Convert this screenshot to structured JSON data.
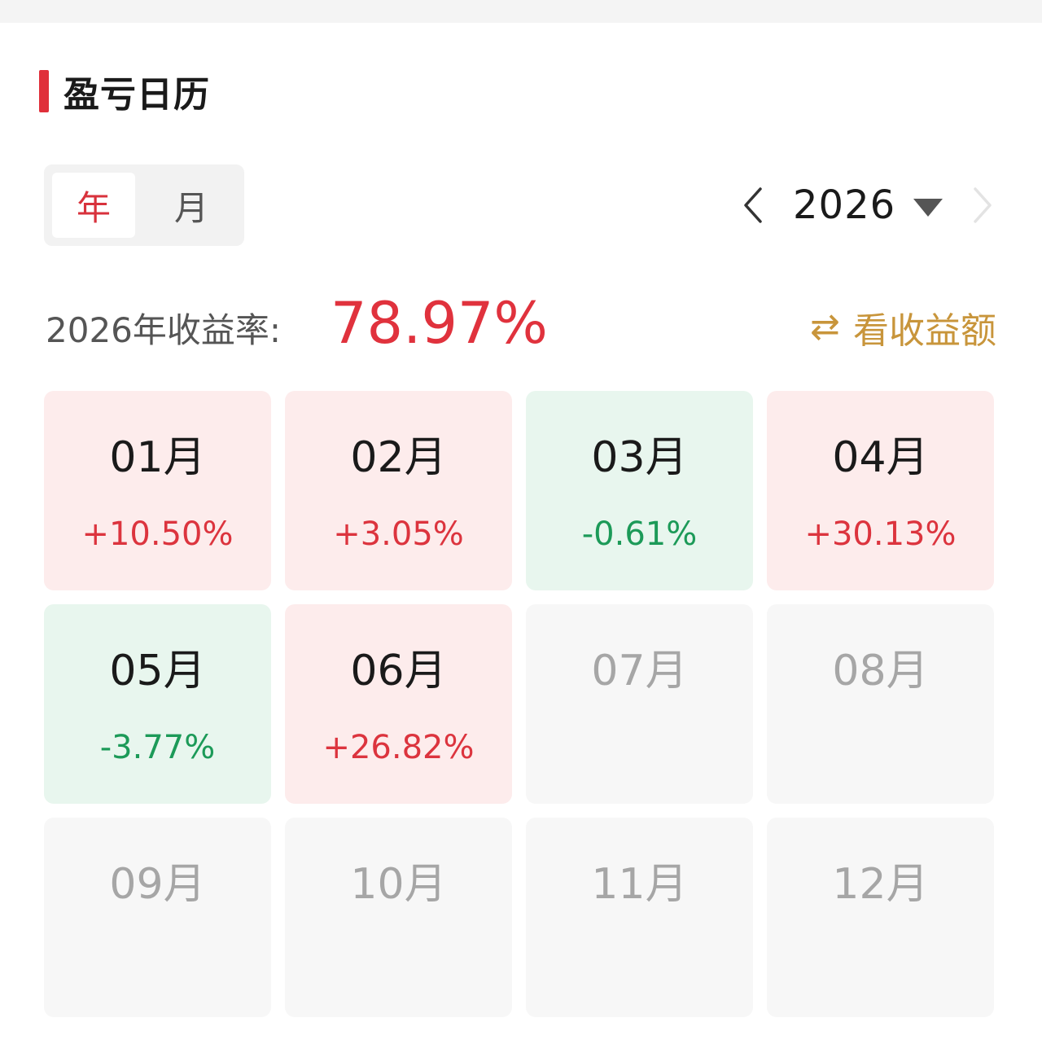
{
  "section": {
    "title": "盈亏日历"
  },
  "period_tabs": [
    {
      "label": "年",
      "active": true
    },
    {
      "label": "月",
      "active": false
    }
  ],
  "year_nav": {
    "year": "2026",
    "prev_icon": "chevron-left-icon",
    "next_icon": "chevron-right-icon",
    "next_enabled": false
  },
  "annual_return": {
    "label": "2026年收益率:",
    "value": "78.97%"
  },
  "view_toggle": {
    "icon": "swap-arrows-icon",
    "label": "看收益额"
  },
  "colors": {
    "accent": "#e02f3a",
    "gain_text": "#dc343e",
    "gain_bg": "#fdecec",
    "loss_text": "#1c9a58",
    "loss_bg": "#e8f6ee",
    "empty_bg": "#f7f7f7",
    "toggle": "#c8953b"
  },
  "months": [
    {
      "label": "01月",
      "pct": "+10.50%",
      "status": "up"
    },
    {
      "label": "02月",
      "pct": "+3.05%",
      "status": "up"
    },
    {
      "label": "03月",
      "pct": "-0.61%",
      "status": "down"
    },
    {
      "label": "04月",
      "pct": "+30.13%",
      "status": "up"
    },
    {
      "label": "05月",
      "pct": "-3.77%",
      "status": "down"
    },
    {
      "label": "06月",
      "pct": "+26.82%",
      "status": "up"
    },
    {
      "label": "07月",
      "pct": "",
      "status": "empty"
    },
    {
      "label": "08月",
      "pct": "",
      "status": "empty"
    },
    {
      "label": "09月",
      "pct": "",
      "status": "empty"
    },
    {
      "label": "10月",
      "pct": "",
      "status": "empty"
    },
    {
      "label": "11月",
      "pct": "",
      "status": "empty"
    },
    {
      "label": "12月",
      "pct": "",
      "status": "empty"
    }
  ]
}
